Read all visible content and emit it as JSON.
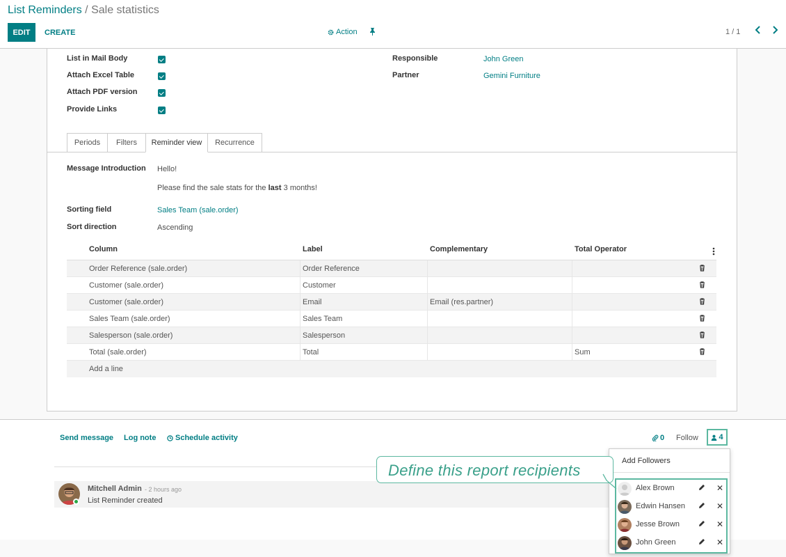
{
  "breadcrumb": {
    "parent": "List Reminders",
    "separator": "/",
    "current": "Sale statistics"
  },
  "toolbar": {
    "edit_label": "EDIT",
    "create_label": "CREATE",
    "action_label": "Action",
    "pager_text": "1 / 1"
  },
  "form": {
    "checks": [
      {
        "label": "List in Mail Body",
        "checked": true
      },
      {
        "label": "Attach Excel Table",
        "checked": true
      },
      {
        "label": "Attach PDF version",
        "checked": true
      },
      {
        "label": "Provide Links",
        "checked": true
      }
    ],
    "responsible_label": "Responsible",
    "responsible_value": "John Green",
    "partner_label": "Partner",
    "partner_value": "Gemini Furniture"
  },
  "tabs": [
    "Periods",
    "Filters",
    "Reminder view",
    "Recurrence"
  ],
  "active_tab": "Reminder view",
  "reminder_view": {
    "message_intro_label": "Message Introduction",
    "message_line1": "Hello!",
    "message_line2_pre": "Please find the sale stats for the",
    "message_line2_bold": "last",
    "message_line2_post": "3 months!",
    "sorting_field_label": "Sorting field",
    "sorting_field_value": "Sales Team (sale.order)",
    "sort_direction_label": "Sort direction",
    "sort_direction_value": "Ascending"
  },
  "table": {
    "headers": [
      "Column",
      "Label",
      "Complementary",
      "Total Operator"
    ],
    "rows": [
      {
        "column": "Order Reference (sale.order)",
        "label": "Order Reference",
        "complementary": "",
        "total_operator": ""
      },
      {
        "column": "Customer (sale.order)",
        "label": "Customer",
        "complementary": "",
        "total_operator": ""
      },
      {
        "column": "Customer (sale.order)",
        "label": "Email",
        "complementary": "Email (res.partner)",
        "total_operator": ""
      },
      {
        "column": "Sales Team (sale.order)",
        "label": "Sales Team",
        "complementary": "",
        "total_operator": ""
      },
      {
        "column": "Salesperson (sale.order)",
        "label": "Salesperson",
        "complementary": "",
        "total_operator": ""
      },
      {
        "column": "Total (sale.order)",
        "label": "Total",
        "complementary": "",
        "total_operator": "Sum"
      }
    ],
    "add_line_label": "Add a line"
  },
  "chatter": {
    "send_message": "Send message",
    "log_note": "Log note",
    "schedule_activity": "Schedule activity",
    "attachments_count": "0",
    "follow_label": "Follow",
    "followers_count": "4",
    "message": {
      "author": "Mitchell Admin",
      "date": "- 2 hours ago",
      "body": "List Reminder created"
    }
  },
  "followers_dropdown": {
    "add_label": "Add Followers",
    "followers": [
      {
        "name": "Alex Brown"
      },
      {
        "name": "Edwin Hansen"
      },
      {
        "name": "Jesse Brown"
      },
      {
        "name": "John Green"
      }
    ]
  },
  "callout": {
    "text": "Define this report recipients"
  },
  "colors": {
    "primary": "#017e84",
    "highlight": "#5cb8a0"
  }
}
